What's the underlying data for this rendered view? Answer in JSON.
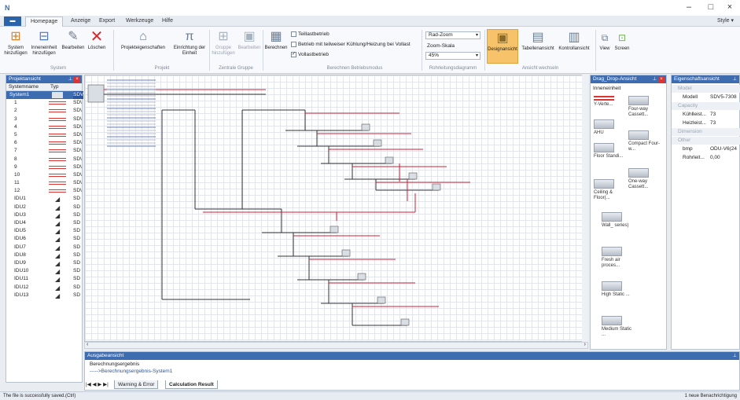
{
  "window": {
    "logo": "N",
    "minimize": "–",
    "maximize": "□",
    "close": "×"
  },
  "menu": {
    "app_button": "▬",
    "tabs": [
      "Homepage",
      "Anzeige",
      "Export",
      "Werkzeuge",
      "Hilfe"
    ],
    "style_label": "Style ▾"
  },
  "ribbon": {
    "system_group": {
      "label": "System",
      "buttons": [
        "System hinzufügen",
        "Inneneinheit hinzufügen"
      ]
    },
    "edit_group": {
      "buttons": [
        "Bearbeiten",
        "Löschen"
      ]
    },
    "project_group": {
      "label": "Projekt",
      "buttons": [
        "Projekteigenschaften",
        "Einrichtung der Einheit"
      ]
    },
    "central_group": {
      "label": "Zentrale Gruppe",
      "buttons": [
        "Gruppe hinzufügen",
        "Bearbeiten"
      ]
    },
    "calc_button": "Berechnen",
    "calc_mode_group": {
      "label": "Berechnen Betriebsmodus",
      "options": [
        {
          "label": "Teillastbetrieb",
          "checked": false
        },
        {
          "label": "Betrieb mit teilweiser Kühlung/Heizung bei Vollast",
          "checked": false
        },
        {
          "label": "Vollastbetrieb",
          "checked": true
        }
      ]
    },
    "diagram_group": {
      "label": "Rohrleitungsdiagramm",
      "zoom_select": "Rad-Zoom",
      "zoom_scale_label": "Zoom-Skala",
      "zoom_value": "45%"
    },
    "view_group": {
      "label": "Ansicht wechseln",
      "buttons": [
        "Designansicht",
        "Tabellenansicht",
        "Kontrollansicht"
      ]
    },
    "extra_buttons": [
      "View",
      "Screen"
    ]
  },
  "project_panel": {
    "title": "Projektansicht",
    "columns": [
      "Systemname",
      "Typ"
    ],
    "rows": [
      {
        "name": "System1",
        "model": "SDV"
      },
      {
        "name": "1",
        "model": "SD\\"
      },
      {
        "name": "2",
        "model": "SD\\"
      },
      {
        "name": "3",
        "model": "SD\\"
      },
      {
        "name": "4",
        "model": "SD\\"
      },
      {
        "name": "5",
        "model": "SD\\"
      },
      {
        "name": "6",
        "model": "SD\\"
      },
      {
        "name": "7",
        "model": "SD\\"
      },
      {
        "name": "8",
        "model": "SD\\"
      },
      {
        "name": "9",
        "model": "SD\\"
      },
      {
        "name": "10",
        "model": "SD\\"
      },
      {
        "name": "11",
        "model": "SD\\"
      },
      {
        "name": "12",
        "model": "SD\\"
      },
      {
        "name": "IDU1",
        "model": "SD"
      },
      {
        "name": "IDU2",
        "model": "SD"
      },
      {
        "name": "IDU3",
        "model": "SD"
      },
      {
        "name": "IDU4",
        "model": "SD"
      },
      {
        "name": "IDU5",
        "model": "SD"
      },
      {
        "name": "IDU6",
        "model": "SD"
      },
      {
        "name": "IDU7",
        "model": "SD"
      },
      {
        "name": "IDU8",
        "model": "SD"
      },
      {
        "name": "IDU9",
        "model": "SD"
      },
      {
        "name": "IDU10",
        "model": "SD"
      },
      {
        "name": "IDU11",
        "model": "SD"
      },
      {
        "name": "IDU12",
        "model": "SD"
      },
      {
        "name": "IDU13",
        "model": "SD"
      }
    ]
  },
  "dragdrop_panel": {
    "title": "Drag_Drop-Ansicht",
    "section": "Inneneinheit",
    "items": [
      "Y-Verte...",
      "Four-way Cassett...",
      "AHU",
      "Compact Four-w...",
      "Floor Standi...",
      "One-way Cassett...",
      "Ceiling & Floor(...",
      "Wall_ series)",
      "Fresh air proces...",
      "High Static ...",
      "Medium Static ..."
    ]
  },
  "props_panel": {
    "title": "Eigenschaftsansicht",
    "rows": [
      {
        "type": "cat",
        "key": "Model"
      },
      {
        "type": "val",
        "key": "Modell",
        "value": "SDV5-7308"
      },
      {
        "type": "cat",
        "key": "Capacity"
      },
      {
        "type": "val",
        "key": "Kühlleist...",
        "value": "73"
      },
      {
        "type": "val",
        "key": "Heizleist...",
        "value": "73"
      },
      {
        "type": "cat",
        "key": "Dimension"
      },
      {
        "type": "cat",
        "key": "Other"
      },
      {
        "type": "val",
        "key": "bmp",
        "value": "ODU-V6(24"
      },
      {
        "type": "val",
        "key": "Rohrleit...",
        "value": "0,00"
      }
    ]
  },
  "output_panel": {
    "title": "Ausgabeansicht",
    "line1": "Berechnungsergebnis",
    "line2": "----->Berechnungsergebnis-System1"
  },
  "bottom_tabs": {
    "nav": "|◀ ◀ ▶ ▶|",
    "tabs": [
      "Warning & Error",
      "Calculation Result"
    ]
  },
  "status": {
    "left": "The file is successfully saved.(Ctrl)",
    "right": "1 neue Benachrichtigung"
  }
}
